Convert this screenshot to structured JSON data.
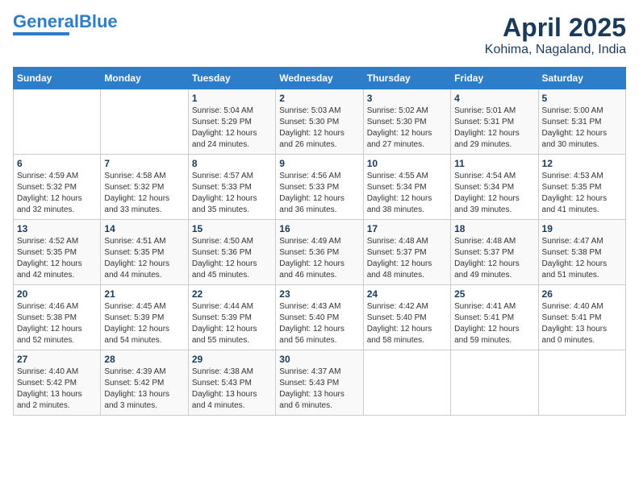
{
  "logo": {
    "line1": "General",
    "line2": "Blue"
  },
  "title": "April 2025",
  "subtitle": "Kohima, Nagaland, India",
  "weekdays": [
    "Sunday",
    "Monday",
    "Tuesday",
    "Wednesday",
    "Thursday",
    "Friday",
    "Saturday"
  ],
  "weeks": [
    [
      {
        "num": "",
        "sunrise": "",
        "sunset": "",
        "daylight": ""
      },
      {
        "num": "",
        "sunrise": "",
        "sunset": "",
        "daylight": ""
      },
      {
        "num": "1",
        "sunrise": "Sunrise: 5:04 AM",
        "sunset": "Sunset: 5:29 PM",
        "daylight": "Daylight: 12 hours and 24 minutes."
      },
      {
        "num": "2",
        "sunrise": "Sunrise: 5:03 AM",
        "sunset": "Sunset: 5:30 PM",
        "daylight": "Daylight: 12 hours and 26 minutes."
      },
      {
        "num": "3",
        "sunrise": "Sunrise: 5:02 AM",
        "sunset": "Sunset: 5:30 PM",
        "daylight": "Daylight: 12 hours and 27 minutes."
      },
      {
        "num": "4",
        "sunrise": "Sunrise: 5:01 AM",
        "sunset": "Sunset: 5:31 PM",
        "daylight": "Daylight: 12 hours and 29 minutes."
      },
      {
        "num": "5",
        "sunrise": "Sunrise: 5:00 AM",
        "sunset": "Sunset: 5:31 PM",
        "daylight": "Daylight: 12 hours and 30 minutes."
      }
    ],
    [
      {
        "num": "6",
        "sunrise": "Sunrise: 4:59 AM",
        "sunset": "Sunset: 5:32 PM",
        "daylight": "Daylight: 12 hours and 32 minutes."
      },
      {
        "num": "7",
        "sunrise": "Sunrise: 4:58 AM",
        "sunset": "Sunset: 5:32 PM",
        "daylight": "Daylight: 12 hours and 33 minutes."
      },
      {
        "num": "8",
        "sunrise": "Sunrise: 4:57 AM",
        "sunset": "Sunset: 5:33 PM",
        "daylight": "Daylight: 12 hours and 35 minutes."
      },
      {
        "num": "9",
        "sunrise": "Sunrise: 4:56 AM",
        "sunset": "Sunset: 5:33 PM",
        "daylight": "Daylight: 12 hours and 36 minutes."
      },
      {
        "num": "10",
        "sunrise": "Sunrise: 4:55 AM",
        "sunset": "Sunset: 5:34 PM",
        "daylight": "Daylight: 12 hours and 38 minutes."
      },
      {
        "num": "11",
        "sunrise": "Sunrise: 4:54 AM",
        "sunset": "Sunset: 5:34 PM",
        "daylight": "Daylight: 12 hours and 39 minutes."
      },
      {
        "num": "12",
        "sunrise": "Sunrise: 4:53 AM",
        "sunset": "Sunset: 5:35 PM",
        "daylight": "Daylight: 12 hours and 41 minutes."
      }
    ],
    [
      {
        "num": "13",
        "sunrise": "Sunrise: 4:52 AM",
        "sunset": "Sunset: 5:35 PM",
        "daylight": "Daylight: 12 hours and 42 minutes."
      },
      {
        "num": "14",
        "sunrise": "Sunrise: 4:51 AM",
        "sunset": "Sunset: 5:35 PM",
        "daylight": "Daylight: 12 hours and 44 minutes."
      },
      {
        "num": "15",
        "sunrise": "Sunrise: 4:50 AM",
        "sunset": "Sunset: 5:36 PM",
        "daylight": "Daylight: 12 hours and 45 minutes."
      },
      {
        "num": "16",
        "sunrise": "Sunrise: 4:49 AM",
        "sunset": "Sunset: 5:36 PM",
        "daylight": "Daylight: 12 hours and 46 minutes."
      },
      {
        "num": "17",
        "sunrise": "Sunrise: 4:48 AM",
        "sunset": "Sunset: 5:37 PM",
        "daylight": "Daylight: 12 hours and 48 minutes."
      },
      {
        "num": "18",
        "sunrise": "Sunrise: 4:48 AM",
        "sunset": "Sunset: 5:37 PM",
        "daylight": "Daylight: 12 hours and 49 minutes."
      },
      {
        "num": "19",
        "sunrise": "Sunrise: 4:47 AM",
        "sunset": "Sunset: 5:38 PM",
        "daylight": "Daylight: 12 hours and 51 minutes."
      }
    ],
    [
      {
        "num": "20",
        "sunrise": "Sunrise: 4:46 AM",
        "sunset": "Sunset: 5:38 PM",
        "daylight": "Daylight: 12 hours and 52 minutes."
      },
      {
        "num": "21",
        "sunrise": "Sunrise: 4:45 AM",
        "sunset": "Sunset: 5:39 PM",
        "daylight": "Daylight: 12 hours and 54 minutes."
      },
      {
        "num": "22",
        "sunrise": "Sunrise: 4:44 AM",
        "sunset": "Sunset: 5:39 PM",
        "daylight": "Daylight: 12 hours and 55 minutes."
      },
      {
        "num": "23",
        "sunrise": "Sunrise: 4:43 AM",
        "sunset": "Sunset: 5:40 PM",
        "daylight": "Daylight: 12 hours and 56 minutes."
      },
      {
        "num": "24",
        "sunrise": "Sunrise: 4:42 AM",
        "sunset": "Sunset: 5:40 PM",
        "daylight": "Daylight: 12 hours and 58 minutes."
      },
      {
        "num": "25",
        "sunrise": "Sunrise: 4:41 AM",
        "sunset": "Sunset: 5:41 PM",
        "daylight": "Daylight: 12 hours and 59 minutes."
      },
      {
        "num": "26",
        "sunrise": "Sunrise: 4:40 AM",
        "sunset": "Sunset: 5:41 PM",
        "daylight": "Daylight: 13 hours and 0 minutes."
      }
    ],
    [
      {
        "num": "27",
        "sunrise": "Sunrise: 4:40 AM",
        "sunset": "Sunset: 5:42 PM",
        "daylight": "Daylight: 13 hours and 2 minutes."
      },
      {
        "num": "28",
        "sunrise": "Sunrise: 4:39 AM",
        "sunset": "Sunset: 5:42 PM",
        "daylight": "Daylight: 13 hours and 3 minutes."
      },
      {
        "num": "29",
        "sunrise": "Sunrise: 4:38 AM",
        "sunset": "Sunset: 5:43 PM",
        "daylight": "Daylight: 13 hours and 4 minutes."
      },
      {
        "num": "30",
        "sunrise": "Sunrise: 4:37 AM",
        "sunset": "Sunset: 5:43 PM",
        "daylight": "Daylight: 13 hours and 6 minutes."
      },
      {
        "num": "",
        "sunrise": "",
        "sunset": "",
        "daylight": ""
      },
      {
        "num": "",
        "sunrise": "",
        "sunset": "",
        "daylight": ""
      },
      {
        "num": "",
        "sunrise": "",
        "sunset": "",
        "daylight": ""
      }
    ]
  ]
}
